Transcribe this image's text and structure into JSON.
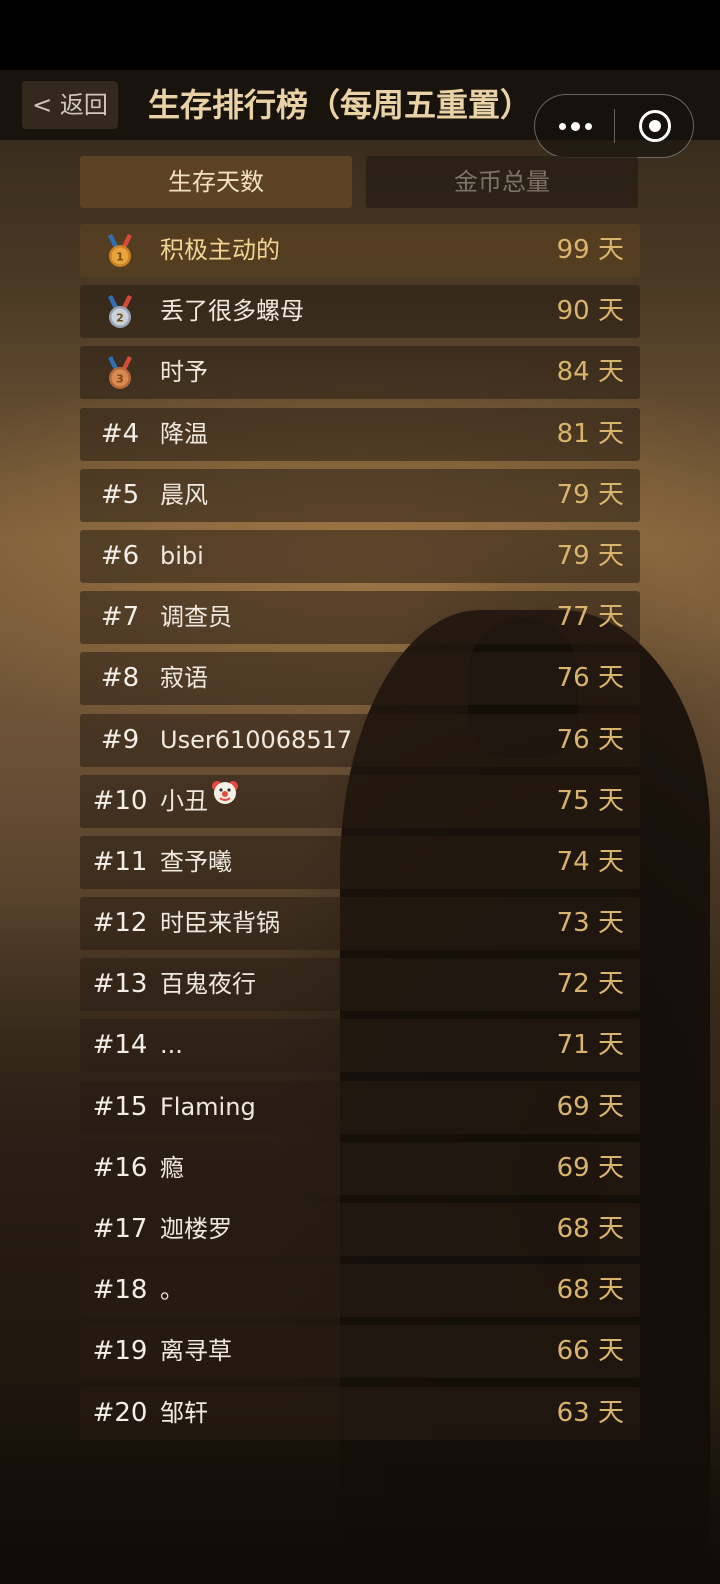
{
  "header": {
    "back_label": "< 返回",
    "title": "生存排行榜（每周五重置）"
  },
  "tabs": [
    {
      "label": "生存天数",
      "active": true
    },
    {
      "label": "金币总量",
      "active": false
    }
  ],
  "medal_icons": [
    "gold-medal-icon",
    "silver-medal-icon",
    "bronze-medal-icon"
  ],
  "rows": [
    {
      "rank": "",
      "name": "积极主动的",
      "days": "99 天"
    },
    {
      "rank": "",
      "name": "丢了很多螺母",
      "days": "90 天"
    },
    {
      "rank": "",
      "name": "时予",
      "days": "84 天"
    },
    {
      "rank": "#4",
      "name": "降温",
      "days": "81 天"
    },
    {
      "rank": "#5",
      "name": "晨风",
      "days": "79 天"
    },
    {
      "rank": "#6",
      "name": "bibi",
      "days": "79 天"
    },
    {
      "rank": "#7",
      "name": "调查员",
      "days": "77 天"
    },
    {
      "rank": "#8",
      "name": "寂语",
      "days": "76 天"
    },
    {
      "rank": "#9",
      "name": "User610068517",
      "days": "76 天"
    },
    {
      "rank": "#10",
      "name": "小丑",
      "days": "75 天"
    },
    {
      "rank": "#11",
      "name": "查予曦",
      "days": "74 天"
    },
    {
      "rank": "#12",
      "name": "时臣来背锅",
      "days": "73 天"
    },
    {
      "rank": "#13",
      "name": "百鬼夜行",
      "days": "72 天"
    },
    {
      "rank": "#14",
      "name": "...",
      "days": "71 天"
    },
    {
      "rank": "#15",
      "name": "Flaming",
      "days": "69 天"
    },
    {
      "rank": "#16",
      "name": "瘾",
      "days": "69 天"
    },
    {
      "rank": "#17",
      "name": "迦楼罗",
      "days": "68 天"
    },
    {
      "rank": "#18",
      "name": "。",
      "days": "68 天"
    },
    {
      "rank": "#19",
      "name": "离寻草",
      "days": "66 天"
    },
    {
      "rank": "#20",
      "name": "邹轩",
      "days": "63 天"
    }
  ],
  "colors": {
    "accent_gold": "#d9b46c",
    "title_gold": "#e8d2a6",
    "active_tab": "#5f4424"
  }
}
